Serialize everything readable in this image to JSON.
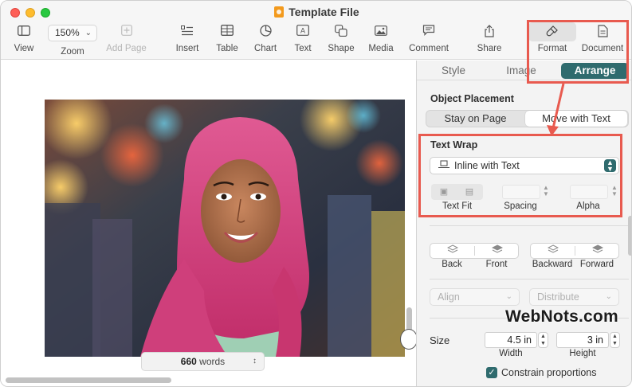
{
  "window": {
    "title": "Template File"
  },
  "toolbar": {
    "zoom_value": "150%",
    "items": [
      {
        "name": "view",
        "label": "View",
        "icon": "sidebar-icon"
      },
      {
        "name": "zoom",
        "label": "Zoom",
        "icon": "zoom-dropdown"
      },
      {
        "name": "add-page",
        "label": "Add Page",
        "icon": "plus-square-icon",
        "disabled": true
      },
      {
        "name": "insert",
        "label": "Insert",
        "icon": "list-icon"
      },
      {
        "name": "table",
        "label": "Table",
        "icon": "table-icon"
      },
      {
        "name": "chart",
        "label": "Chart",
        "icon": "pie-chart-icon"
      },
      {
        "name": "text",
        "label": "Text",
        "icon": "text-box-icon"
      },
      {
        "name": "shape",
        "label": "Shape",
        "icon": "shape-icon"
      },
      {
        "name": "media",
        "label": "Media",
        "icon": "image-icon"
      },
      {
        "name": "comment",
        "label": "Comment",
        "icon": "comment-icon"
      },
      {
        "name": "share",
        "label": "Share",
        "icon": "share-icon"
      },
      {
        "name": "format",
        "label": "Format",
        "icon": "paintbrush-icon"
      },
      {
        "name": "document",
        "label": "Document",
        "icon": "document-icon"
      }
    ]
  },
  "canvas": {
    "word_count_value": "660",
    "word_count_unit": "words"
  },
  "inspector": {
    "tabs": [
      "Style",
      "Image",
      "Arrange"
    ],
    "active_tab": "Arrange",
    "object_placement": {
      "label": "Object Placement",
      "options": [
        "Stay on Page",
        "Move with Text"
      ],
      "selected": "Move with Text"
    },
    "text_wrap": {
      "label": "Text Wrap",
      "value": "Inline with Text",
      "text_fit_label": "Text Fit",
      "spacing_label": "Spacing",
      "alpha_label": "Alpha"
    },
    "layer_buttons": {
      "back": "Back",
      "front": "Front",
      "backward": "Backward",
      "forward": "Forward"
    },
    "align": {
      "label": "Align"
    },
    "distribute": {
      "label": "Distribute"
    },
    "size": {
      "label": "Size",
      "width_value": "4.5 in",
      "height_value": "3 in",
      "width_label": "Width",
      "height_label": "Height",
      "constrain_label": "Constrain proportions",
      "constrain_checked": true
    }
  },
  "watermark": "WebNots.com",
  "colors": {
    "accent": "#2f6b6e",
    "highlight": "#e85a4f",
    "scarf": "#d6407e"
  }
}
